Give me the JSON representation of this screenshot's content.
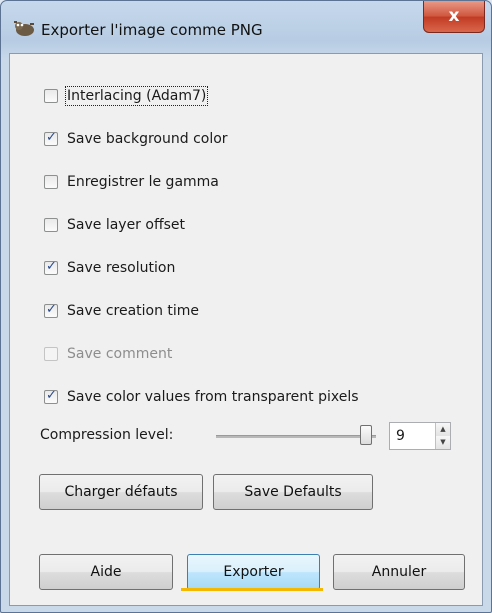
{
  "window": {
    "title": "Exporter l'image comme PNG",
    "close_label": "x",
    "icon": "gimp-wilber-icon"
  },
  "options": [
    {
      "label": "Interlacing (Adam7)",
      "checked": false,
      "disabled": false,
      "focused": true
    },
    {
      "label": "Save background color",
      "checked": true,
      "disabled": false
    },
    {
      "label": "Enregistrer le gamma",
      "checked": false,
      "disabled": false
    },
    {
      "label": "Save layer offset",
      "checked": false,
      "disabled": false
    },
    {
      "label": "Save resolution",
      "checked": true,
      "disabled": false
    },
    {
      "label": "Save creation time",
      "checked": true,
      "disabled": false
    },
    {
      "label": "Save comment",
      "checked": false,
      "disabled": true
    },
    {
      "label": "Save color values from transparent pixels",
      "checked": true,
      "disabled": false
    }
  ],
  "compression": {
    "label": "Compression level:",
    "value": "9",
    "level_fraction": 0.95
  },
  "buttons": {
    "load_defaults": "Charger défauts",
    "save_defaults": "Save Defaults",
    "help": "Aide",
    "export": "Exporter",
    "cancel": "Annuler"
  },
  "colors": {
    "highlight_underline": "#f5b800",
    "title_bar": "#b7cce3",
    "close_button": "#c03a22"
  }
}
